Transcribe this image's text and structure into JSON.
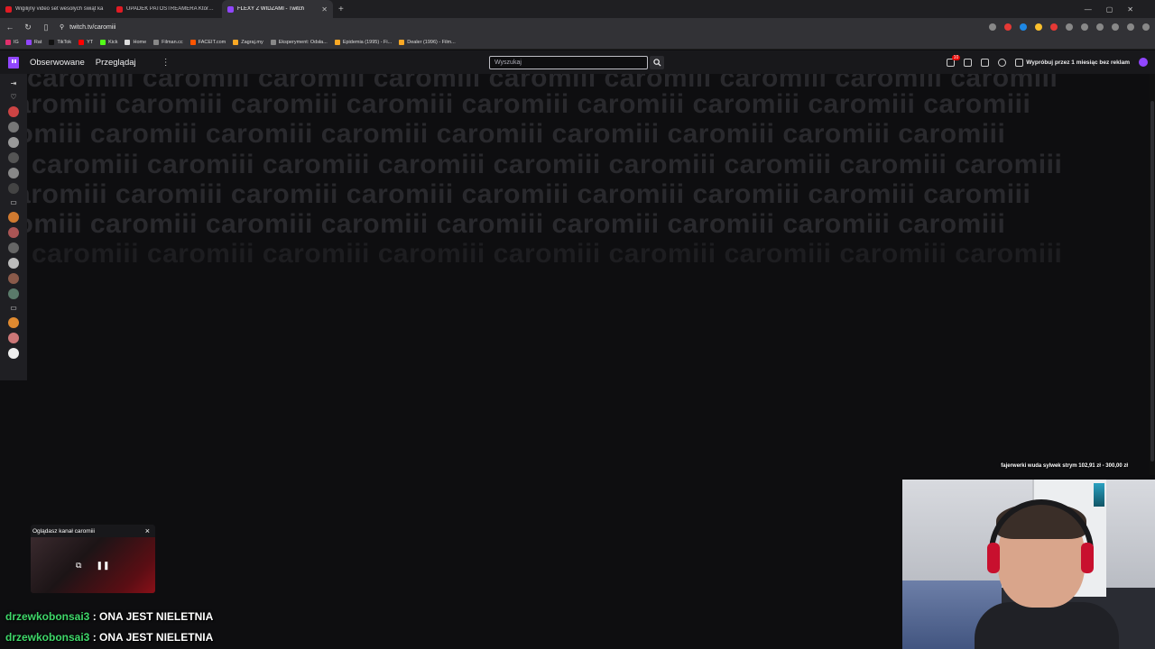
{
  "browser": {
    "tabs": [
      {
        "label": "Wigilijny video set wesołych świąt ka",
        "active": false
      },
      {
        "label": "UPADEK PATOSTREAMERA Którego C",
        "active": false
      },
      {
        "label": "FLEXY Z WIDZAMI - Twitch",
        "active": true
      }
    ],
    "new_tab": "+",
    "address": "twitch.tv/caromiii",
    "bookmarks": [
      "IG",
      "Rat",
      "TikTok",
      "YT",
      "Kick",
      "Home",
      "Filman.cc",
      "FACEIT.com",
      "Zagraj.my",
      "Eksperyment: Odsła...",
      "Epidemia (1995) - Fi...",
      "Dealer (1996) - Film..."
    ]
  },
  "twitch": {
    "nav": {
      "following": "Obserwowane",
      "browse": "Przeglądaj",
      "more": "⋮",
      "search_placeholder": "Wyszukaj",
      "notif_count": "10",
      "turbo_label": "Wypróbuj przez 1 miesiąc bez reklam"
    },
    "banner_text": "caromiii",
    "miniplayer": {
      "title": "Oglądasz kanał caromiii",
      "close": "×"
    }
  },
  "overlay": {
    "donation_ticker": "fajerwerki wuda sylwek strym 102,91 zł ‐ 300,00 zł",
    "chat": [
      {
        "user": "drzewkobonsai3",
        "message": "ONA JEST NIELETNIA"
      },
      {
        "user": "drzewkobonsai3",
        "message": "ONA JEST NIELETNIA"
      }
    ]
  },
  "colors": {
    "twitch_purple": "#9146ff",
    "chat_username": "#3fd86a",
    "background": "#0e0e10"
  }
}
